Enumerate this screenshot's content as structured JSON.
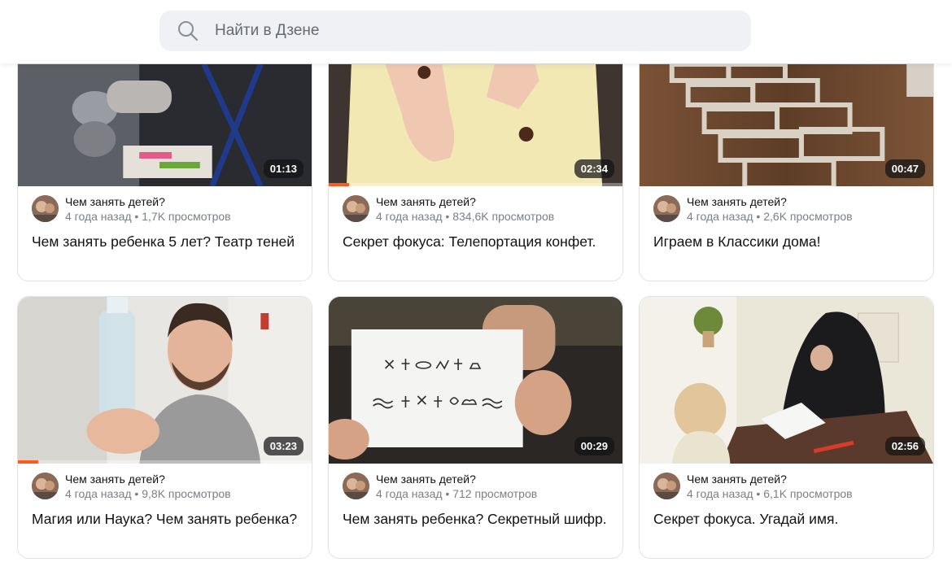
{
  "search": {
    "placeholder": "Найти в Дзене",
    "icon": "search-icon"
  },
  "cards": [
    {
      "channel": "Чем занять детей?",
      "age": "4 года назад",
      "views": "1,7K просмотров",
      "title": "Чем занять ребенка 5 лет? Театр теней",
      "duration": "01:13",
      "progress": 0
    },
    {
      "channel": "Чем занять детей?",
      "age": "4 года назад",
      "views": "834,6K просмотров",
      "title": "Секрет фокуса: Телепортация конфет.",
      "duration": "02:34",
      "progress": 0.07
    },
    {
      "channel": "Чем занять детей?",
      "age": "4 года назад",
      "views": "2,6K просмотров",
      "title": "Играем в Классики дома!",
      "duration": "00:47",
      "progress": 0
    },
    {
      "channel": "Чем занять детей?",
      "age": "4 года назад",
      "views": "9,8K просмотров",
      "title": "Магия или Наука? Чем занять ребенка?",
      "duration": "03:23",
      "progress": 0.07
    },
    {
      "channel": "Чем занять детей?",
      "age": "4 года назад",
      "views": "712 просмотров",
      "title": "Чем занять ребенка? Секретный шифр.",
      "duration": "00:29",
      "progress": 0
    },
    {
      "channel": "Чем занять детей?",
      "age": "4 года назад",
      "views": "6,1K просмотров",
      "title": "Секрет фокуса. Угадай имя.",
      "duration": "02:56",
      "progress": 0
    }
  ],
  "stats_separator": " • ",
  "colors": {
    "progress": "#ff5a1f",
    "search_bg": "#f0f1f4",
    "stats": "#7b7f86"
  }
}
